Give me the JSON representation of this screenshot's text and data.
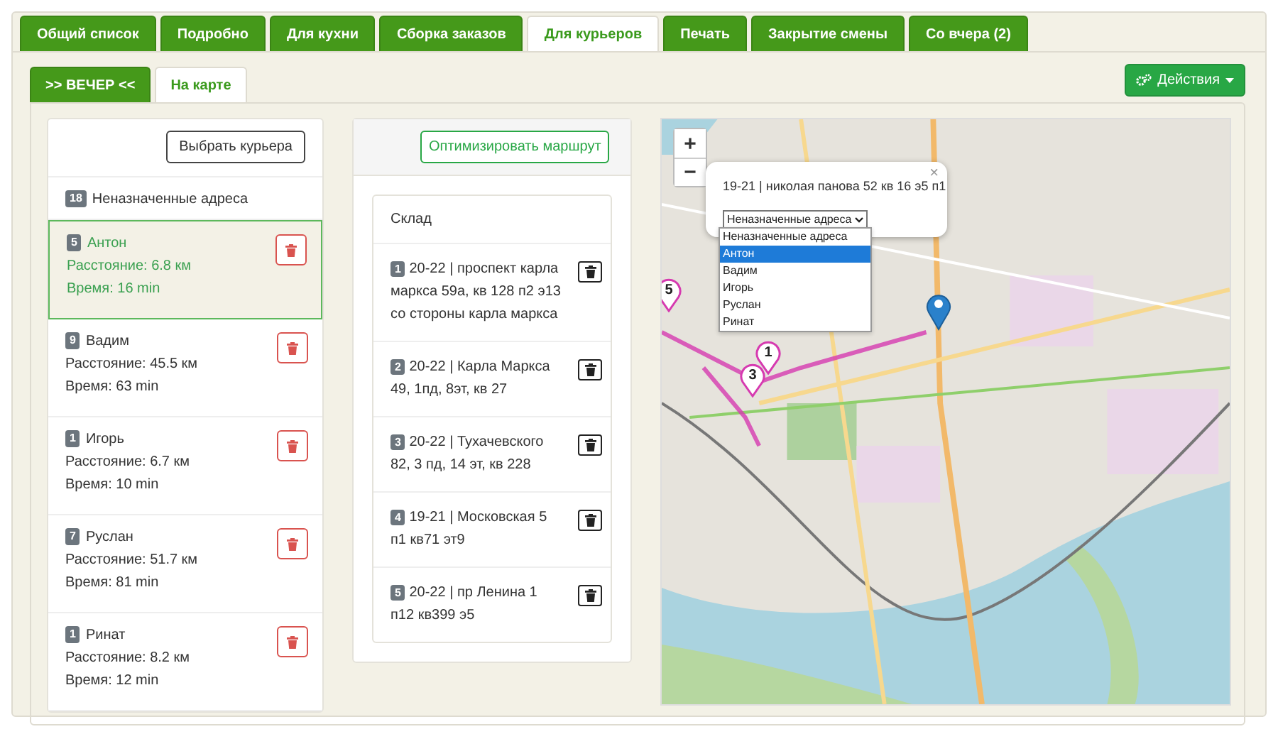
{
  "tabs": [
    {
      "label": "Общий список",
      "selected": false
    },
    {
      "label": "Подробно",
      "selected": false
    },
    {
      "label": "Для кухни",
      "selected": false
    },
    {
      "label": "Сборка заказов",
      "selected": false
    },
    {
      "label": "Для курьеров",
      "selected": true
    },
    {
      "label": "Печать",
      "selected": false
    },
    {
      "label": "Закрытие смены",
      "selected": false
    },
    {
      "label": "Со вчера (2)",
      "selected": false
    }
  ],
  "subtabs": [
    {
      "label": ">> ВЕЧЕР <<",
      "selected": false
    },
    {
      "label": "На карте",
      "selected": true
    }
  ],
  "actions_button": {
    "label": "Действия"
  },
  "couriers_panel": {
    "select_button": "Выбрать курьера",
    "unassigned": {
      "count": "18",
      "label": "Неназначенные адреса"
    },
    "couriers": [
      {
        "count": "5",
        "name": "Антон",
        "distance": "Расстояние: 6.8 км",
        "time": "Время: 16 min",
        "selected": true
      },
      {
        "count": "9",
        "name": "Вадим",
        "distance": "Расстояние: 45.5 км",
        "time": "Время: 63 min",
        "selected": false
      },
      {
        "count": "1",
        "name": "Игорь",
        "distance": "Расстояние: 6.7 км",
        "time": "Время: 10 min",
        "selected": false
      },
      {
        "count": "7",
        "name": "Руслан",
        "distance": "Расстояние: 51.7 км",
        "time": "Время: 81 min",
        "selected": false
      },
      {
        "count": "1",
        "name": "Ринат",
        "distance": "Расстояние: 8.2 км",
        "time": "Время: 12 min",
        "selected": false
      }
    ]
  },
  "route_panel": {
    "optimize_button": "Оптимизировать маршрут",
    "start": "Склад",
    "stops": [
      {
        "number": "1",
        "text": "20-22 | проспект карла маркса 59а, кв 128 п2 э13 со стороны карла маркса"
      },
      {
        "number": "2",
        "text": "20-22 | Карла Маркса 49, 1пд, 8эт, кв 27"
      },
      {
        "number": "3",
        "text": "20-22 | Тухачевского 82, 3 пд, 14 эт, кв 228"
      },
      {
        "number": "4",
        "text": "19-21 | Московская 5 п1 кв71 эт9"
      },
      {
        "number": "5",
        "text": "20-22 | пр Ленина 1 п12 кв399 э5"
      }
    ]
  },
  "map": {
    "zoom_in": "+",
    "zoom_out": "−",
    "markers": [
      {
        "label": "5"
      },
      {
        "label": "1"
      },
      {
        "label": "3"
      }
    ],
    "popup": {
      "text": "19-21 | николая панова 52 кв 16 э5 п1",
      "close": "×",
      "select_value": "Неназначенные адреса",
      "options": [
        {
          "label": "Неназначенные адреса",
          "selected": false
        },
        {
          "label": "Антон",
          "selected": true
        },
        {
          "label": "Вадим",
          "selected": false
        },
        {
          "label": "Игорь",
          "selected": false
        },
        {
          "label": "Руслан",
          "selected": false
        },
        {
          "label": "Ринат",
          "selected": false
        }
      ]
    }
  }
}
